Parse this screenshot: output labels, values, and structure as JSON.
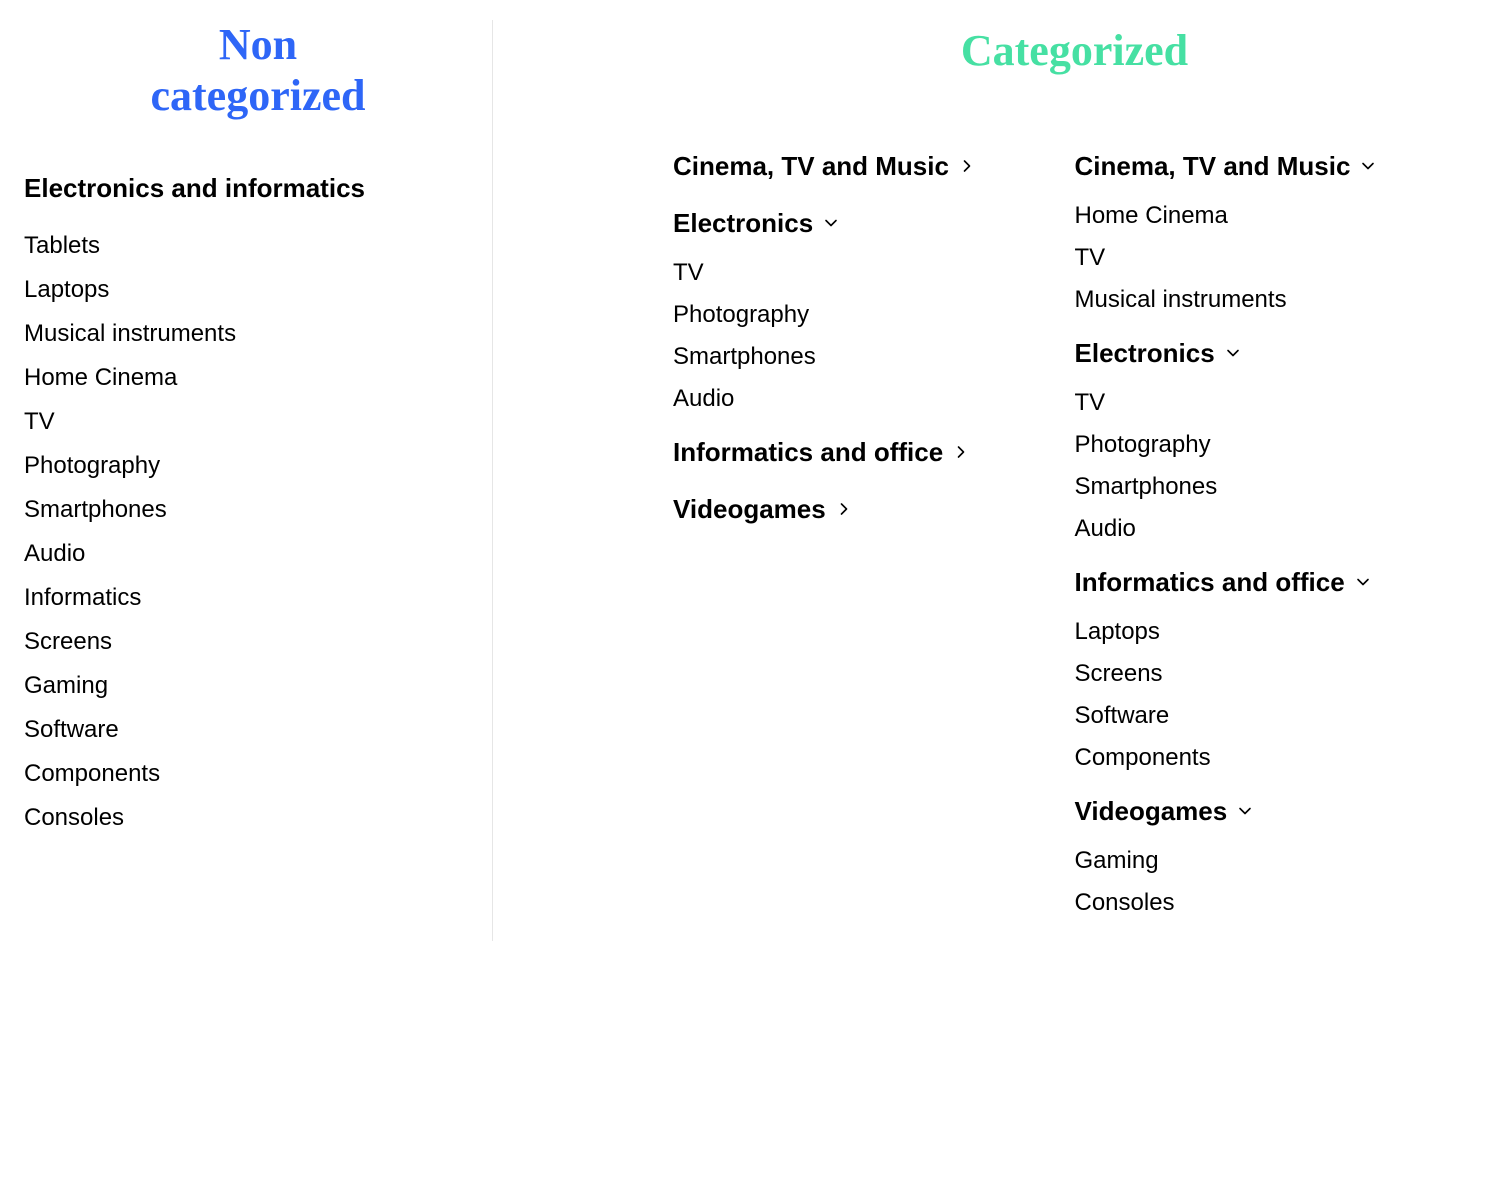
{
  "headings": {
    "left_line1": "Non",
    "left_line2": "categorized",
    "right": "Categorized"
  },
  "noncat": {
    "title": "Electronics and informatics",
    "items": [
      "Tablets",
      "Laptops",
      "Musical instruments",
      "Home Cinema",
      "TV",
      "Photography",
      "Smartphones",
      "Audio",
      "Informatics",
      "Screens",
      "Gaming",
      "Software",
      "Components",
      "Consoles"
    ]
  },
  "cat_col1": [
    {
      "title": "Cinema, TV and Music",
      "state": "collapsed",
      "items": []
    },
    {
      "title": "Electronics",
      "state": "expanded",
      "items": [
        "TV",
        "Photography",
        "Smartphones",
        "Audio"
      ]
    },
    {
      "title": "Informatics and office",
      "state": "collapsed",
      "items": []
    },
    {
      "title": "Videogames",
      "state": "collapsed",
      "items": []
    }
  ],
  "cat_col2": [
    {
      "title": "Cinema, TV and Music",
      "state": "expanded",
      "items": [
        "Home Cinema",
        "TV",
        "Musical instruments"
      ]
    },
    {
      "title": "Electronics",
      "state": "expanded",
      "items": [
        "TV",
        "Photography",
        "Smartphones",
        "Audio"
      ]
    },
    {
      "title": "Informatics and office",
      "state": "expanded",
      "items": [
        "Laptops",
        "Screens",
        "Software",
        "Components"
      ]
    },
    {
      "title": "Videogames",
      "state": "expanded",
      "items": [
        "Gaming",
        "Consoles"
      ]
    }
  ]
}
